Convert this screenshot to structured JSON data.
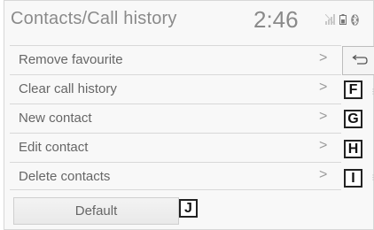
{
  "header": {
    "title": "Contacts/Call history",
    "clock": "2:46",
    "status_icons": [
      "signal-icon",
      "battery-icon",
      "bluetooth-icon"
    ]
  },
  "menu": {
    "items": [
      {
        "label": "Remove favourite",
        "chevron": ">"
      },
      {
        "label": "Clear call history",
        "chevron": ">"
      },
      {
        "label": "New contact",
        "chevron": ">"
      },
      {
        "label": "Edit contact",
        "chevron": ">"
      },
      {
        "label": "Delete contacts",
        "chevron": ">"
      }
    ]
  },
  "back_button": {
    "icon": "back-arrow-icon"
  },
  "default_button": {
    "label": "Default"
  },
  "callouts": {
    "f": "F",
    "g": "G",
    "h": "H",
    "i": "I",
    "j": "J"
  }
}
